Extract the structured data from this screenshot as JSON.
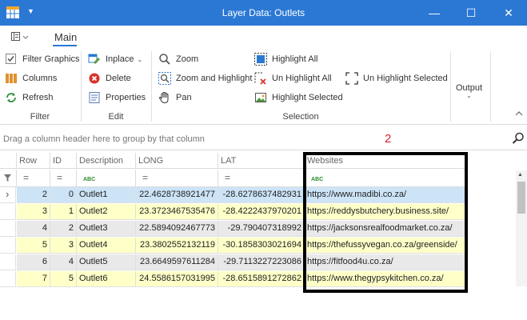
{
  "window": {
    "title": "Layer Data: Outlets",
    "minimize_glyph": "—",
    "maximize_glyph": "☐",
    "close_glyph": "✕",
    "menu_glyph": "▼"
  },
  "tabs": {
    "main": "Main"
  },
  "ribbon": {
    "filter": {
      "filter_graphics": "Filter Graphics",
      "columns": "Columns",
      "refresh": "Refresh",
      "group_label": "Filter"
    },
    "edit": {
      "inplace": "Inplace",
      "delete": "Delete",
      "properties": "Properties",
      "group_label": "Edit"
    },
    "selection": {
      "zoom": "Zoom",
      "zoom_and_highlight": "Zoom and Highlight",
      "pan": "Pan",
      "highlight_all": "Highlight All",
      "un_highlight_all": "Un Highlight All",
      "highlight_selected": "Highlight Selected",
      "un_highlight_selected": "Un Highlight Selected",
      "group_label": "Selection"
    },
    "output": {
      "label": "Output"
    }
  },
  "groupbar": {
    "hint": "Drag a column header here to group by that column",
    "record_count": "2"
  },
  "table": {
    "columns": [
      "Row",
      "ID",
      "Description",
      "LONG",
      "LAT",
      "Websites"
    ],
    "filter_equals_glyph": "=",
    "filter_abc_glyph": "ABC",
    "rows": [
      {
        "row": "2",
        "id": "0",
        "description": "Outlet1",
        "long": "22.4628738921477",
        "lat": "-28.6278637482931",
        "website": "https://www.madibi.co.za/"
      },
      {
        "row": "3",
        "id": "1",
        "description": "Outlet2",
        "long": "23.3723467535476",
        "lat": "-28.4222437970201",
        "website": "https://reddysbutchery.business.site/"
      },
      {
        "row": "4",
        "id": "2",
        "description": "Outlet3",
        "long": "22.5894092467773",
        "lat": "-29.790407318992",
        "website": "https://jacksonsrealfoodmarket.co.za/"
      },
      {
        "row": "5",
        "id": "3",
        "description": "Outlet4",
        "long": "23.3802552132119",
        "lat": "-30.1858303021694",
        "website": "https://thefussyvegan.co.za/greenside/"
      },
      {
        "row": "6",
        "id": "4",
        "description": "Outlet5",
        "long": "23.6649597611284",
        "lat": "-29.7113227223086",
        "website": "https://fitfood4u.co.za/"
      },
      {
        "row": "7",
        "id": "5",
        "description": "Outlet6",
        "long": "24.5586157031995",
        "lat": "-28.6515891272862",
        "website": "https://www.thegypsykitchen.co.za/"
      }
    ]
  },
  "colors": {
    "titlebar": "#2b78d4",
    "selected_row": "#cde4f7",
    "odd_row": "#ffffc8",
    "even_row": "#e9e9e9",
    "record_count": "#d8222f"
  }
}
